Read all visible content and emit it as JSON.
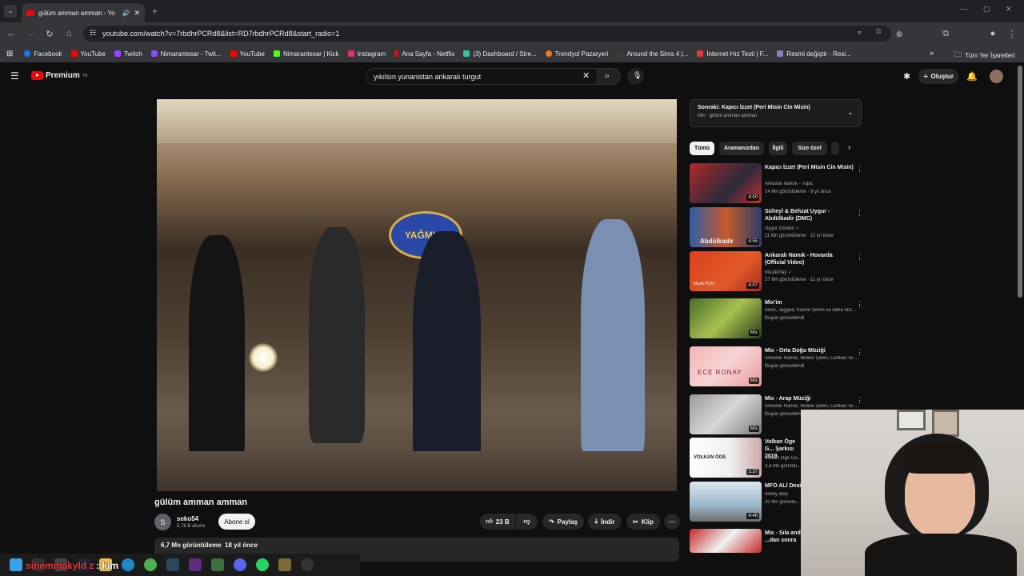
{
  "browser": {
    "tab_title": "gülüm amman amman - Yo",
    "url": "youtube.com/watch?v=7rbdhrPCRd8&list=RD7rbdhrPCRd8&start_radio=1",
    "bookmarks": [
      "Facebook",
      "YouTube",
      "Twitch",
      "Nimarantesar - Twit...",
      "YouTube",
      "Nimarantesar | Kick",
      "Instagram",
      "Ana Sayfa - Netflix",
      "(3) Dashboard / Stre...",
      "Trendyol Pazaryeri",
      "Around the Sims 4 |...",
      "İnternet Hız Testi | F...",
      "Resmi değiştir - Resi..."
    ],
    "all_bookmarks": "Tüm Yer İşaretleri"
  },
  "youtube": {
    "logo_text": "Premium",
    "logo_region": "TR",
    "search_value": "yıkılsın yunanistan ankaralı turgut",
    "create_label": "Oluştur"
  },
  "video": {
    "title": "gülüm amman amman",
    "channel": "seko54",
    "channel_initial": "S",
    "subscribers": "5,78 B abone",
    "subscribe_label": "Abone ol",
    "likes": "23 B",
    "share_label": "Paylaş",
    "download_label": "İndir",
    "clip_label": "Klip",
    "views": "6,7 Mn görüntüleme",
    "age": "18 yıl önce",
    "overlay_sign": "YAĞMUR"
  },
  "mix": {
    "next_label": "Sonraki: Kapıcı İzzet (Peri Misin Cin Misin)",
    "sub_label": "Mix · gülüm amman amman"
  },
  "chips": [
    "Tümü",
    "Aramanızdan",
    "İlgili",
    "Size özel"
  ],
  "recommendations": [
    {
      "title": "Kapıcı İzzet (Peri Misin Cin Misin)",
      "channel": "Ankaralı Namık - Topic",
      "meta": "14 Mn görüntüleme · 9 yıl önce",
      "badge": "4:00"
    },
    {
      "title": "Süheyl & Behzat Uygur - Abdülkadir (DMC)",
      "channel": "Uygur Gösteri ✓",
      "meta": "11 Mn görüntüleme · 12 yıl önce",
      "badge": "4:55",
      "thumb_text": "Abdülkadir"
    },
    {
      "title": "Ankaralı Namık - Hovarda (Official Video)",
      "channel": "MuzikPlay ✓",
      "meta": "27 Mn görüntüleme · 11 yıl önce",
      "badge": "4:07",
      "thumb_text": "Muzik PLAY"
    },
    {
      "title": "Mix'im",
      "channel": "Akon, Jagged, Kasım Şeren ve daha fazl...",
      "meta": "Bugün güncellendi",
      "badge": "Mix"
    },
    {
      "title": "Mix - Orta Doğu Müziği",
      "channel": "Ankaralı Namık, Melike Şahin, Cankan ve ...",
      "meta": "Bugün güncellendi",
      "badge": "Mix",
      "thumb_text": "ECE RONAY"
    },
    {
      "title": "Mix - Arap Müziği",
      "channel": "Ankaralı Namık, Melike Şahin, Cankan ve ...",
      "meta": "Bugün güncellendi",
      "badge": "Mix"
    },
    {
      "title": "Volkan Öge G... Şarkısı 2019",
      "channel": "Volkan Öge Gö...",
      "meta": "3,4 Mn görüntü...",
      "badge": "1:37",
      "thumb_text": "VOLKAN ÖGE"
    },
    {
      "title": "MFÖ ALİ Desi...",
      "channel": "okday ataş",
      "meta": "20 Mn görüntü...",
      "badge": "4:46"
    },
    {
      "title": "Mix - Sıla and ...dan sonra",
      "channel": "",
      "meta": "",
      "badge": ""
    }
  ],
  "stream_overlay": {
    "user": "sinemmakyld z",
    "text": ": kim"
  }
}
